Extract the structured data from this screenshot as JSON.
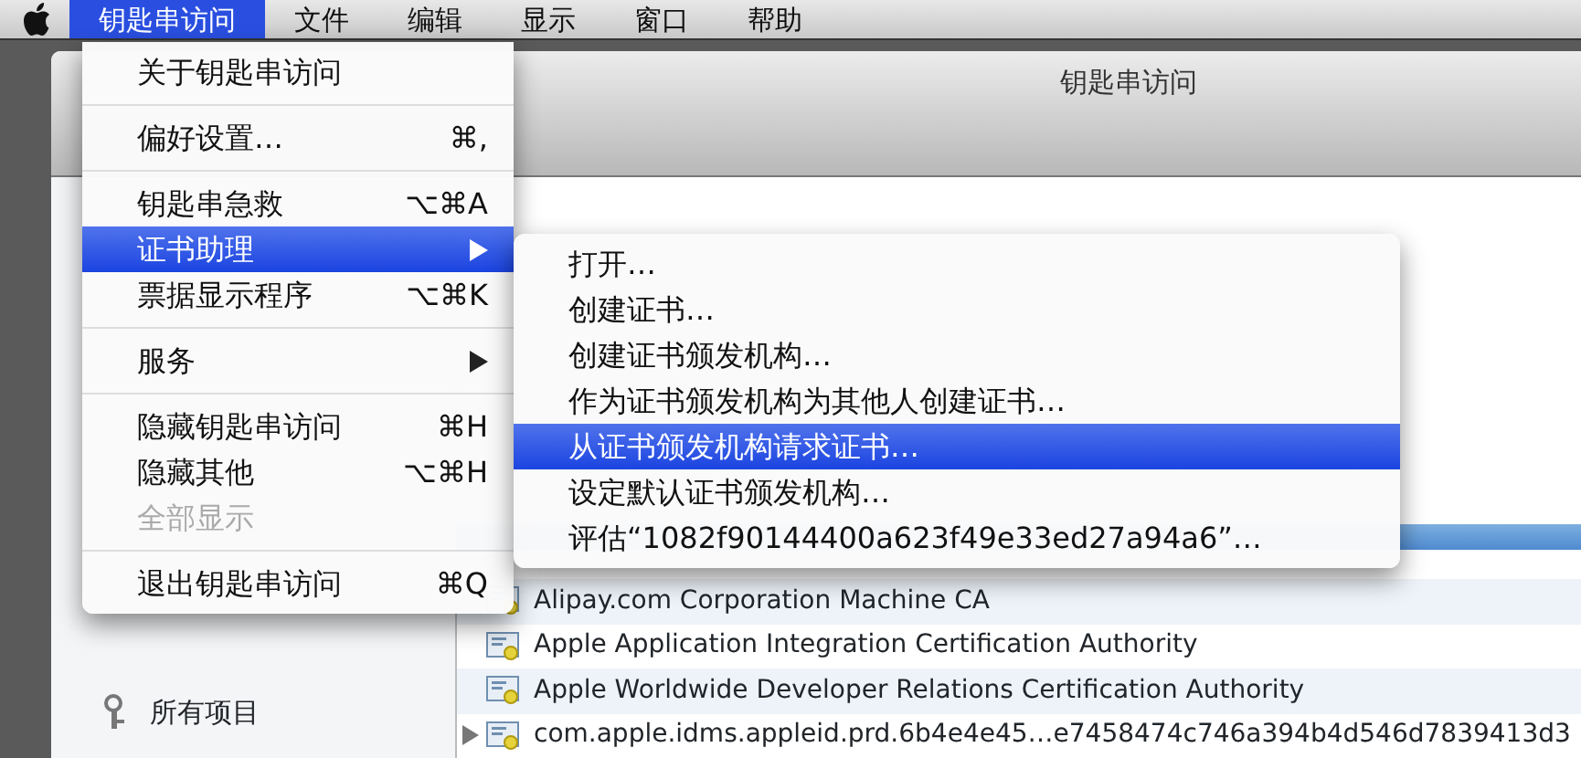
{
  "menubar": {
    "items": [
      {
        "label": "钥匙串访问",
        "selected": true
      },
      {
        "label": "文件",
        "selected": false
      },
      {
        "label": "编辑",
        "selected": false
      },
      {
        "label": "显示",
        "selected": false
      },
      {
        "label": "窗口",
        "selected": false
      },
      {
        "label": "帮助",
        "selected": false
      }
    ]
  },
  "window": {
    "title": "钥匙串访问"
  },
  "sidebar": {
    "items": [
      {
        "label": "所有项目"
      }
    ]
  },
  "list": {
    "rows": [
      {
        "label": "Alipay.com Corporation Machine CA",
        "expandable": false
      },
      {
        "label": "Apple Application Integration Certification Authority",
        "expandable": false
      },
      {
        "label": "Apple Worldwide Developer Relations Certification Authority",
        "expandable": false
      },
      {
        "label": "com.apple.idms.appleid.prd.6b4e4e45…e7458474c746a394b4d546d7839413d3",
        "expandable": true
      }
    ]
  },
  "main_menu": {
    "items": [
      {
        "kind": "item",
        "label": "关于钥匙串访问",
        "selected": false,
        "disabled": false,
        "submenu": false
      },
      {
        "kind": "separator"
      },
      {
        "kind": "item",
        "label": "偏好设置…",
        "shortcut": "⌘,",
        "selected": false,
        "disabled": false,
        "submenu": false
      },
      {
        "kind": "separator"
      },
      {
        "kind": "item",
        "label": "钥匙串急救",
        "shortcut": "⌥⌘A",
        "selected": false,
        "disabled": false,
        "submenu": false
      },
      {
        "kind": "item",
        "label": "证书助理",
        "selected": true,
        "disabled": false,
        "submenu": true
      },
      {
        "kind": "item",
        "label": "票据显示程序",
        "shortcut": "⌥⌘K",
        "selected": false,
        "disabled": false,
        "submenu": false
      },
      {
        "kind": "separator"
      },
      {
        "kind": "item",
        "label": "服务",
        "selected": false,
        "disabled": false,
        "submenu": true
      },
      {
        "kind": "separator"
      },
      {
        "kind": "item",
        "label": "隐藏钥匙串访问",
        "shortcut": "⌘H",
        "selected": false,
        "disabled": false,
        "submenu": false
      },
      {
        "kind": "item",
        "label": "隐藏其他",
        "shortcut": "⌥⌘H",
        "selected": false,
        "disabled": false,
        "submenu": false
      },
      {
        "kind": "item",
        "label": "全部显示",
        "selected": false,
        "disabled": true,
        "submenu": false
      },
      {
        "kind": "separator"
      },
      {
        "kind": "item",
        "label": "退出钥匙串访问",
        "shortcut": "⌘Q",
        "selected": false,
        "disabled": false,
        "submenu": false
      }
    ]
  },
  "submenu": {
    "items": [
      {
        "label": "打开…",
        "selected": false
      },
      {
        "label": "创建证书…",
        "selected": false
      },
      {
        "label": "创建证书颁发机构…",
        "selected": false
      },
      {
        "label": "作为证书颁发机构为其他人创建证书…",
        "selected": false
      },
      {
        "label": "从证书颁发机构请求证书…",
        "selected": true
      },
      {
        "label": "设定默认证书颁发机构…",
        "selected": false
      },
      {
        "label": "评估“1082f90144400a623f49e33ed27a94a6”…",
        "selected": false
      }
    ]
  }
}
